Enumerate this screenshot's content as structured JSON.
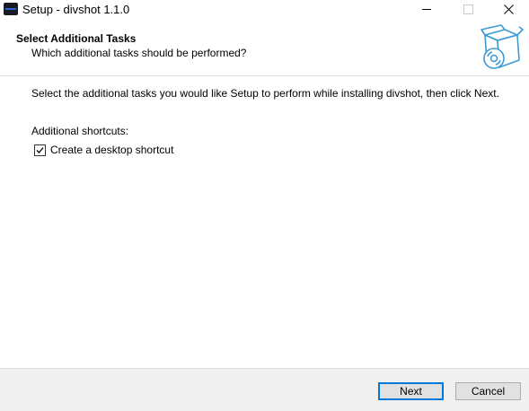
{
  "window": {
    "title": "Setup - divshot 1.1.0",
    "controls": {
      "minimize_icon": "minimize-icon",
      "maximize_icon": "maximize-icon",
      "close_icon": "close-icon"
    }
  },
  "header": {
    "title": "Select Additional Tasks",
    "subtitle": "Which additional tasks should be performed?",
    "image_icon": "software-box-cd-icon"
  },
  "main": {
    "intro": "Select the additional tasks you would like Setup to perform while installing divshot, then click Next.",
    "group_label": "Additional shortcuts:",
    "tasks": [
      {
        "label": "Create a desktop shortcut",
        "checked": true
      }
    ]
  },
  "footer": {
    "next_label": "Next",
    "cancel_label": "Cancel"
  },
  "colors": {
    "accent": "#0078d7",
    "footer_bg": "#f0f0f0",
    "icon_blue": "#3b9bd4"
  }
}
